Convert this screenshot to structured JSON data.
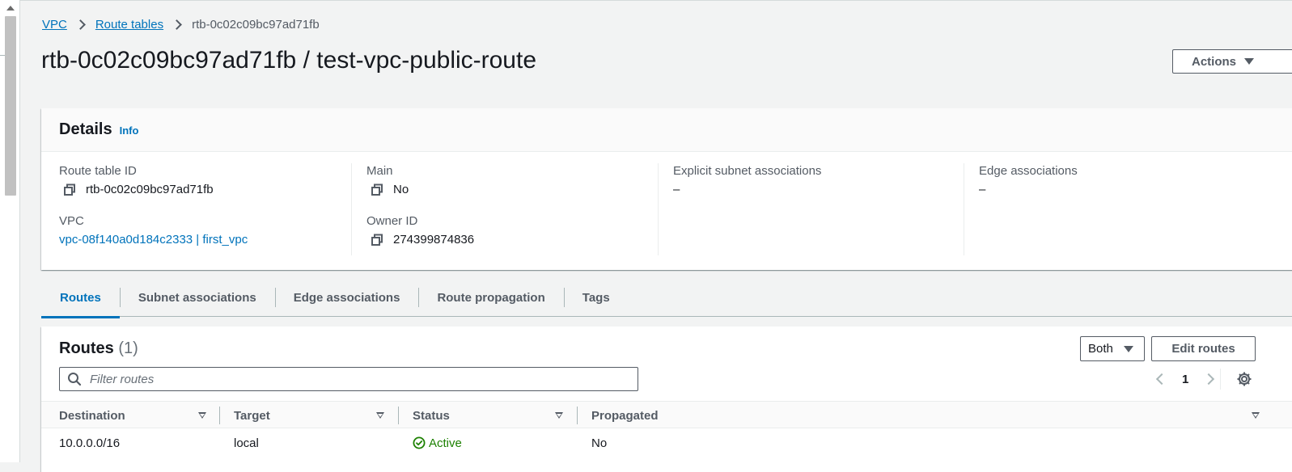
{
  "breadcrumb": {
    "items": [
      "VPC",
      "Route tables"
    ],
    "current": "rtb-0c02c09bc97ad71fb"
  },
  "page": {
    "title": "rtb-0c02c09bc97ad71fb / test-vpc-public-route",
    "actions_label": "Actions"
  },
  "details": {
    "heading": "Details",
    "info_label": "Info",
    "route_table_id_label": "Route table ID",
    "route_table_id": "rtb-0c02c09bc97ad71fb",
    "vpc_label": "VPC",
    "vpc_value": "vpc-08f140a0d184c2333 | first_vpc",
    "main_label": "Main",
    "main_value": "No",
    "owner_id_label": "Owner ID",
    "owner_id": "274399874836",
    "explicit_subnet_label": "Explicit subnet associations",
    "explicit_subnet_value": "–",
    "edge_assoc_label": "Edge associations",
    "edge_assoc_value": "–"
  },
  "tabs": [
    {
      "label": "Routes",
      "active": true
    },
    {
      "label": "Subnet associations",
      "active": false
    },
    {
      "label": "Edge associations",
      "active": false
    },
    {
      "label": "Route propagation",
      "active": false
    },
    {
      "label": "Tags",
      "active": false
    }
  ],
  "routes": {
    "title": "Routes",
    "count": "(1)",
    "filter_selector_value": "Both",
    "edit_label": "Edit routes",
    "filter_placeholder": "Filter routes",
    "page": "1",
    "columns": [
      "Destination",
      "Target",
      "Status",
      "Propagated"
    ],
    "rows": [
      {
        "destination": "10.0.0.0/16",
        "target": "local",
        "status": "Active",
        "propagated": "No"
      }
    ]
  },
  "colors": {
    "link": "#0073bb",
    "status_active": "#1d8102",
    "background": "#f2f3f3"
  }
}
